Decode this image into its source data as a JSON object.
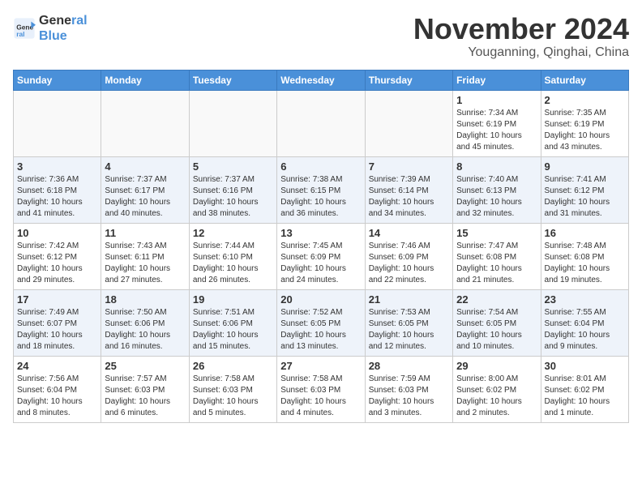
{
  "header": {
    "logo_line1": "General",
    "logo_line2": "Blue",
    "month": "November 2024",
    "location": "Youganning, Qinghai, China"
  },
  "weekdays": [
    "Sunday",
    "Monday",
    "Tuesday",
    "Wednesday",
    "Thursday",
    "Friday",
    "Saturday"
  ],
  "weeks": [
    [
      {
        "day": "",
        "info": ""
      },
      {
        "day": "",
        "info": ""
      },
      {
        "day": "",
        "info": ""
      },
      {
        "day": "",
        "info": ""
      },
      {
        "day": "",
        "info": ""
      },
      {
        "day": "1",
        "info": "Sunrise: 7:34 AM\nSunset: 6:19 PM\nDaylight: 10 hours\nand 45 minutes."
      },
      {
        "day": "2",
        "info": "Sunrise: 7:35 AM\nSunset: 6:19 PM\nDaylight: 10 hours\nand 43 minutes."
      }
    ],
    [
      {
        "day": "3",
        "info": "Sunrise: 7:36 AM\nSunset: 6:18 PM\nDaylight: 10 hours\nand 41 minutes."
      },
      {
        "day": "4",
        "info": "Sunrise: 7:37 AM\nSunset: 6:17 PM\nDaylight: 10 hours\nand 40 minutes."
      },
      {
        "day": "5",
        "info": "Sunrise: 7:37 AM\nSunset: 6:16 PM\nDaylight: 10 hours\nand 38 minutes."
      },
      {
        "day": "6",
        "info": "Sunrise: 7:38 AM\nSunset: 6:15 PM\nDaylight: 10 hours\nand 36 minutes."
      },
      {
        "day": "7",
        "info": "Sunrise: 7:39 AM\nSunset: 6:14 PM\nDaylight: 10 hours\nand 34 minutes."
      },
      {
        "day": "8",
        "info": "Sunrise: 7:40 AM\nSunset: 6:13 PM\nDaylight: 10 hours\nand 32 minutes."
      },
      {
        "day": "9",
        "info": "Sunrise: 7:41 AM\nSunset: 6:12 PM\nDaylight: 10 hours\nand 31 minutes."
      }
    ],
    [
      {
        "day": "10",
        "info": "Sunrise: 7:42 AM\nSunset: 6:12 PM\nDaylight: 10 hours\nand 29 minutes."
      },
      {
        "day": "11",
        "info": "Sunrise: 7:43 AM\nSunset: 6:11 PM\nDaylight: 10 hours\nand 27 minutes."
      },
      {
        "day": "12",
        "info": "Sunrise: 7:44 AM\nSunset: 6:10 PM\nDaylight: 10 hours\nand 26 minutes."
      },
      {
        "day": "13",
        "info": "Sunrise: 7:45 AM\nSunset: 6:09 PM\nDaylight: 10 hours\nand 24 minutes."
      },
      {
        "day": "14",
        "info": "Sunrise: 7:46 AM\nSunset: 6:09 PM\nDaylight: 10 hours\nand 22 minutes."
      },
      {
        "day": "15",
        "info": "Sunrise: 7:47 AM\nSunset: 6:08 PM\nDaylight: 10 hours\nand 21 minutes."
      },
      {
        "day": "16",
        "info": "Sunrise: 7:48 AM\nSunset: 6:08 PM\nDaylight: 10 hours\nand 19 minutes."
      }
    ],
    [
      {
        "day": "17",
        "info": "Sunrise: 7:49 AM\nSunset: 6:07 PM\nDaylight: 10 hours\nand 18 minutes."
      },
      {
        "day": "18",
        "info": "Sunrise: 7:50 AM\nSunset: 6:06 PM\nDaylight: 10 hours\nand 16 minutes."
      },
      {
        "day": "19",
        "info": "Sunrise: 7:51 AM\nSunset: 6:06 PM\nDaylight: 10 hours\nand 15 minutes."
      },
      {
        "day": "20",
        "info": "Sunrise: 7:52 AM\nSunset: 6:05 PM\nDaylight: 10 hours\nand 13 minutes."
      },
      {
        "day": "21",
        "info": "Sunrise: 7:53 AM\nSunset: 6:05 PM\nDaylight: 10 hours\nand 12 minutes."
      },
      {
        "day": "22",
        "info": "Sunrise: 7:54 AM\nSunset: 6:05 PM\nDaylight: 10 hours\nand 10 minutes."
      },
      {
        "day": "23",
        "info": "Sunrise: 7:55 AM\nSunset: 6:04 PM\nDaylight: 10 hours\nand 9 minutes."
      }
    ],
    [
      {
        "day": "24",
        "info": "Sunrise: 7:56 AM\nSunset: 6:04 PM\nDaylight: 10 hours\nand 8 minutes."
      },
      {
        "day": "25",
        "info": "Sunrise: 7:57 AM\nSunset: 6:03 PM\nDaylight: 10 hours\nand 6 minutes."
      },
      {
        "day": "26",
        "info": "Sunrise: 7:58 AM\nSunset: 6:03 PM\nDaylight: 10 hours\nand 5 minutes."
      },
      {
        "day": "27",
        "info": "Sunrise: 7:58 AM\nSunset: 6:03 PM\nDaylight: 10 hours\nand 4 minutes."
      },
      {
        "day": "28",
        "info": "Sunrise: 7:59 AM\nSunset: 6:03 PM\nDaylight: 10 hours\nand 3 minutes."
      },
      {
        "day": "29",
        "info": "Sunrise: 8:00 AM\nSunset: 6:02 PM\nDaylight: 10 hours\nand 2 minutes."
      },
      {
        "day": "30",
        "info": "Sunrise: 8:01 AM\nSunset: 6:02 PM\nDaylight: 10 hours\nand 1 minute."
      }
    ]
  ]
}
